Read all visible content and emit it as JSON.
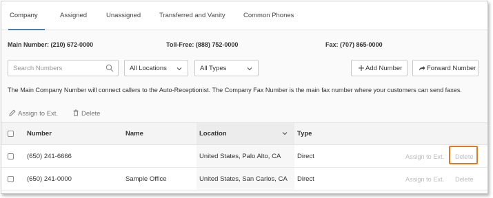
{
  "tabs": [
    {
      "label": "Company",
      "active": true
    },
    {
      "label": "Assigned"
    },
    {
      "label": "Unassigned"
    },
    {
      "label": "Transferred and Vanity"
    },
    {
      "label": "Common Phones"
    }
  ],
  "info": {
    "main_label": "Main Number:",
    "main_value": "(210) 672-0000",
    "tollfree_label": "Toll-Free:",
    "tollfree_value": "(888) 752-0000",
    "fax_label": "Fax:",
    "fax_value": "(707) 865-0000"
  },
  "filters": {
    "search_placeholder": "Search Numbers",
    "location_selected": "All Locations",
    "type_selected": "All Types"
  },
  "buttons": {
    "add_number": "Add Number",
    "forward_number": "Forward Number"
  },
  "description": "The Main Company Number will connect callers to the Auto-Receptionist. The Company Fax Number is the main fax number where your customers can send faxes.",
  "bulk_actions": {
    "assign": "Assign to Ext.",
    "delete": "Delete"
  },
  "table": {
    "headers": {
      "number": "Number",
      "name": "Name",
      "location": "Location",
      "type": "Type"
    },
    "rows": [
      {
        "number": "(650) 241-6666",
        "name": "",
        "location": "United States, Palo Alto, CA",
        "type": "Direct",
        "assign": "Assign to Ext.",
        "delete": "Delete"
      },
      {
        "number": "(650) 241-0000",
        "name": "Sample Office",
        "location": "United States, San Carlos, CA",
        "type": "Direct",
        "assign": "Assign to Ext.",
        "delete": "Delete"
      }
    ]
  },
  "colors": {
    "accent": "#4a7fb5",
    "highlight": "#e07a1f",
    "disabled_text": "#bcbcbc"
  },
  "icons": [
    "search-icon",
    "chevron-down-icon",
    "plus-icon",
    "forward-arrow-icon",
    "pencil-icon",
    "trash-icon",
    "sort-chevron-icon"
  ]
}
